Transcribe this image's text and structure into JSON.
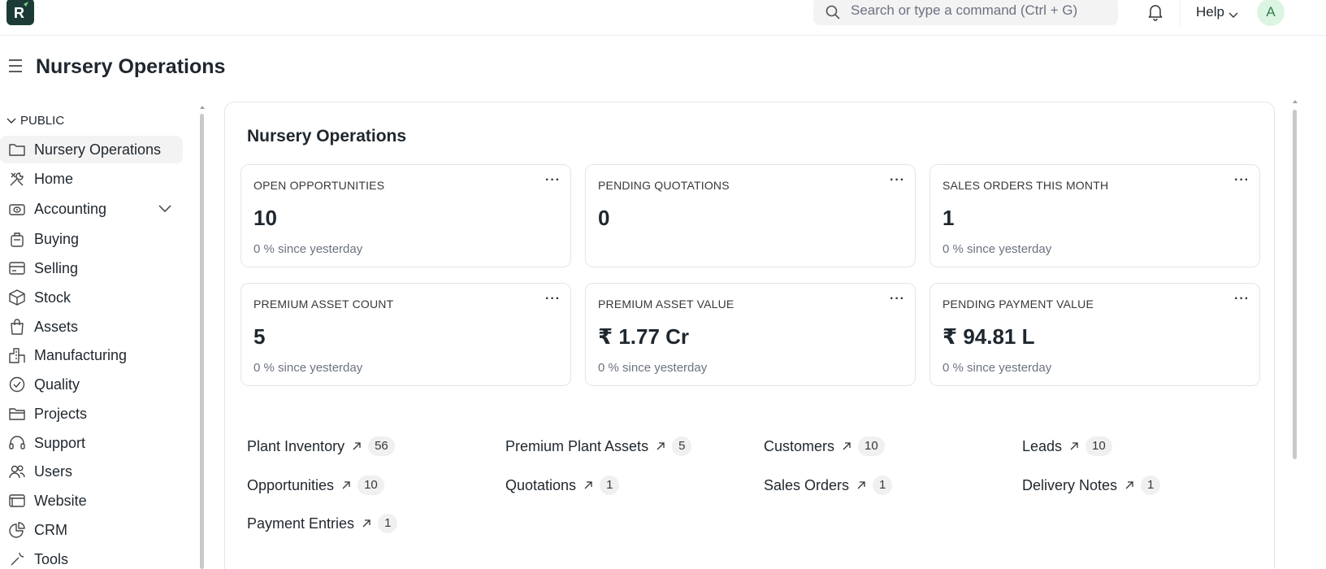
{
  "navbar": {
    "logo_letter": "R",
    "search_placeholder": "Search or type a command (Ctrl + G)",
    "help_label": "Help",
    "avatar_initial": "A"
  },
  "page": {
    "title": "Nursery Operations"
  },
  "sidebar": {
    "section_label": "PUBLIC",
    "items": [
      {
        "label": "Nursery Operations",
        "icon": "folder-icon",
        "active": true
      },
      {
        "label": "Home",
        "icon": "tools-icon"
      },
      {
        "label": "Accounting",
        "icon": "accounting-icon",
        "expandable": true
      },
      {
        "label": "Buying",
        "icon": "buying-icon"
      },
      {
        "label": "Selling",
        "icon": "selling-icon"
      },
      {
        "label": "Stock",
        "icon": "stock-box-icon"
      },
      {
        "label": "Assets",
        "icon": "assets-bag-icon"
      },
      {
        "label": "Manufacturing",
        "icon": "factory-icon"
      },
      {
        "label": "Quality",
        "icon": "quality-badge-icon"
      },
      {
        "label": "Projects",
        "icon": "projects-folder-icon"
      },
      {
        "label": "Support",
        "icon": "headset-icon"
      },
      {
        "label": "Users",
        "icon": "users-icon"
      },
      {
        "label": "Website",
        "icon": "website-icon"
      },
      {
        "label": "CRM",
        "icon": "crm-pie-icon"
      },
      {
        "label": "Tools",
        "icon": "tools-wrench-icon"
      }
    ]
  },
  "workspace": {
    "title": "Nursery Operations",
    "number_cards": [
      {
        "title": "OPEN OPPORTUNITIES",
        "value": "10",
        "sub": "0 % since yesterday"
      },
      {
        "title": "PENDING QUOTATIONS",
        "value": "0",
        "sub": ""
      },
      {
        "title": "SALES ORDERS THIS MONTH",
        "value": "1",
        "sub": "0 % since yesterday"
      },
      {
        "title": "PREMIUM ASSET COUNT",
        "value": "5",
        "sub": "0 % since yesterday"
      },
      {
        "title": "PREMIUM ASSET VALUE",
        "value": "₹ 1.77 Cr",
        "sub": "0 % since yesterday"
      },
      {
        "title": "PENDING PAYMENT VALUE",
        "value": "₹ 94.81 L",
        "sub": "0 % since yesterday"
      }
    ],
    "menu_glyph": "···",
    "shortcuts": [
      {
        "label": "Plant Inventory",
        "count": "56"
      },
      {
        "label": "Premium Plant Assets",
        "count": "5"
      },
      {
        "label": "Customers",
        "count": "10"
      },
      {
        "label": "Leads",
        "count": "10"
      },
      {
        "label": "Opportunities",
        "count": "10"
      },
      {
        "label": "Quotations",
        "count": "1"
      },
      {
        "label": "Sales Orders",
        "count": "1"
      },
      {
        "label": "Delivery Notes",
        "count": "1"
      },
      {
        "label": "Payment Entries",
        "count": "1"
      }
    ]
  },
  "colors": {
    "logo_bg": "#1c3b36",
    "logo_accent": "#7bd389",
    "active_item_bg": "#f3f3f3",
    "avatar_bg": "#dcf5e2"
  }
}
